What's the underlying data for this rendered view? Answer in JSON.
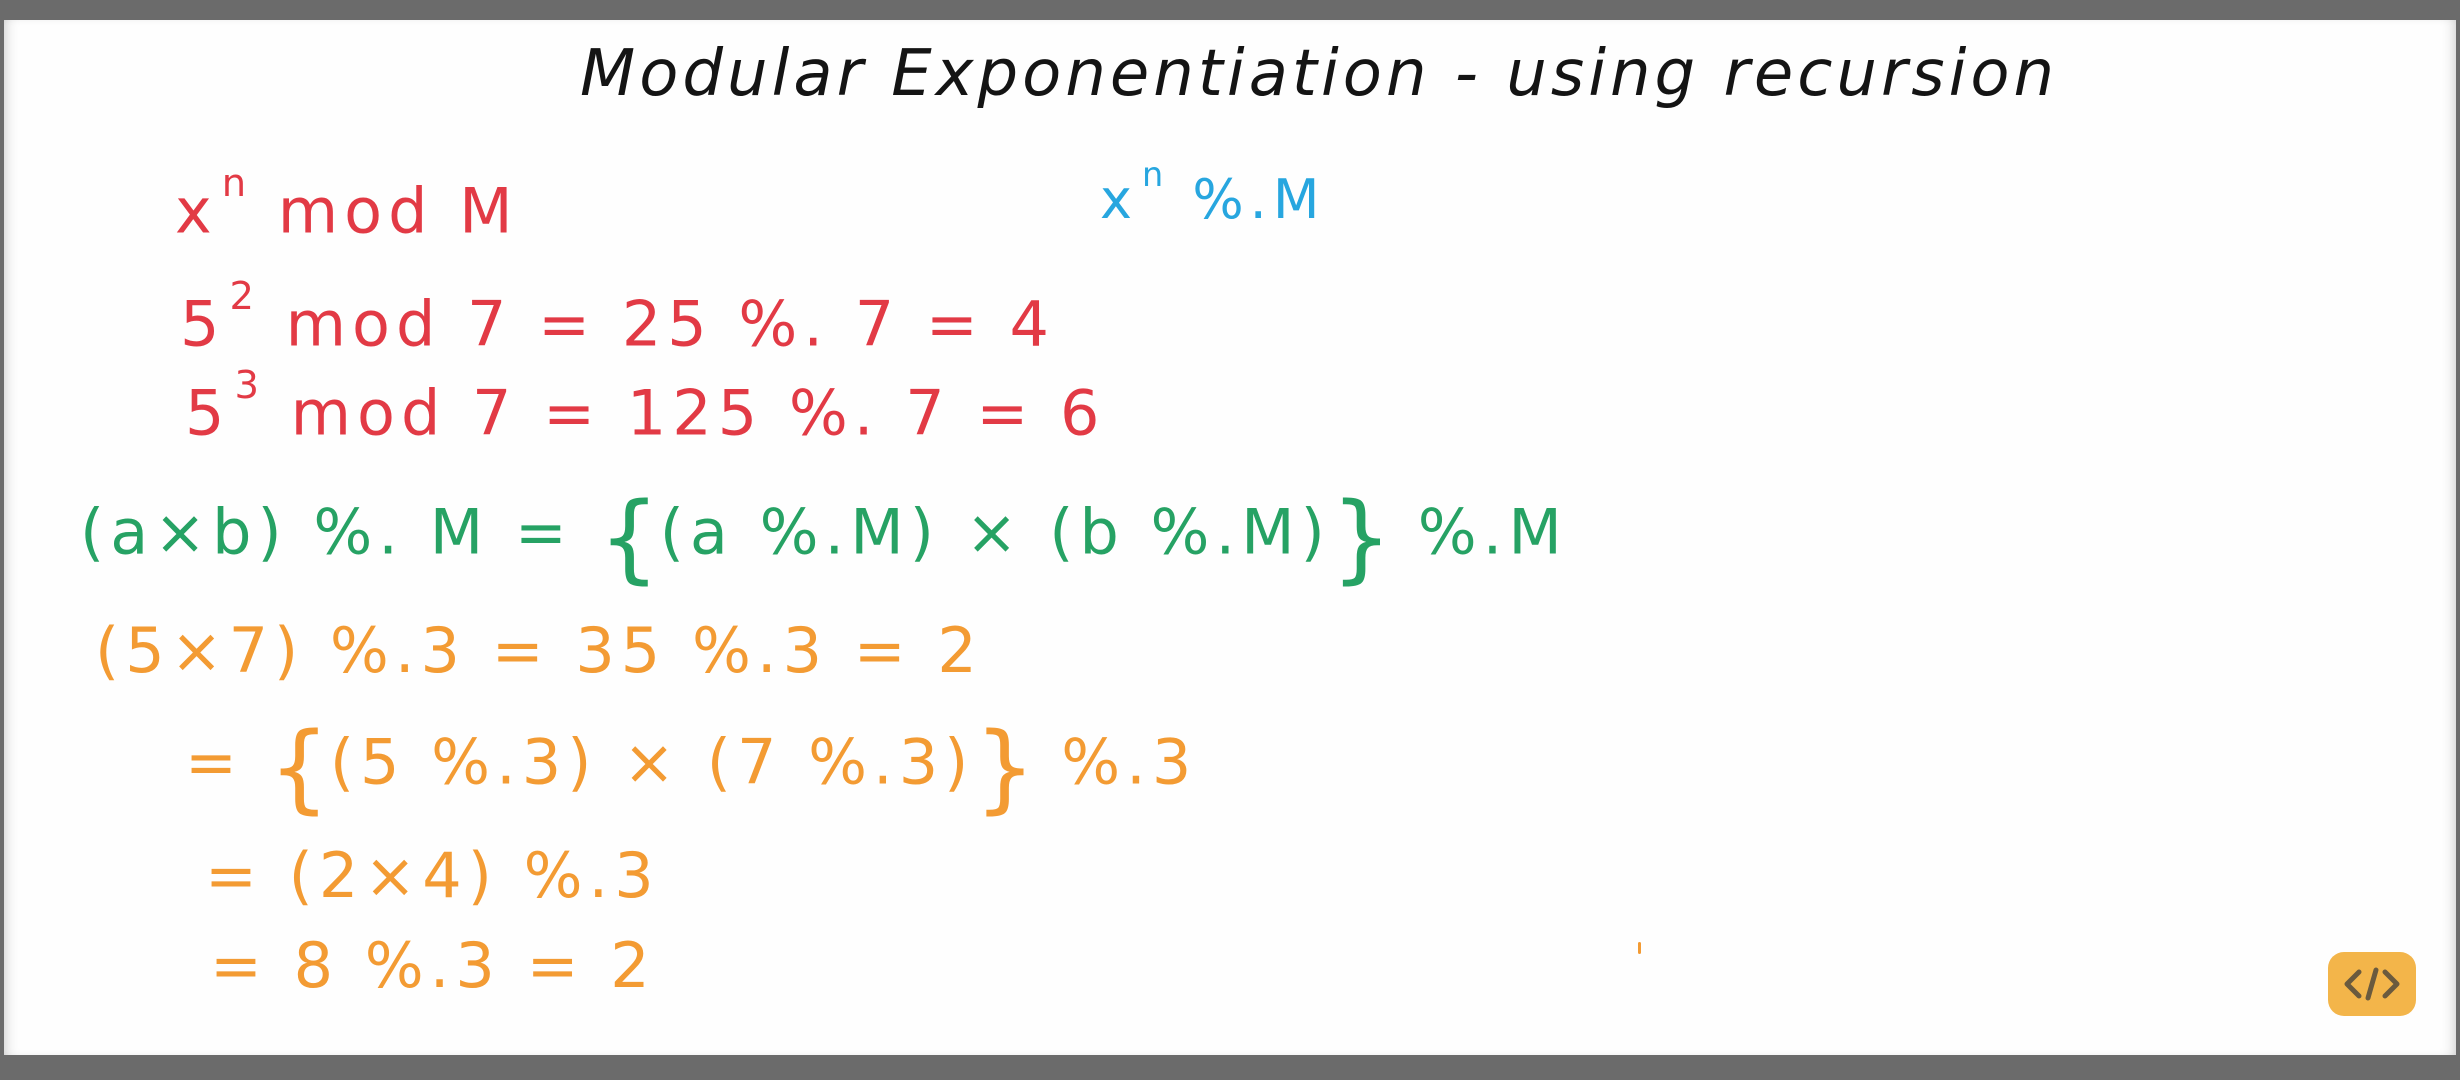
{
  "title": "Modular Exponentiation - using recursion",
  "lines": {
    "line1_base": "x",
    "line1_exp": "n",
    "line1_rest": " mod M",
    "blue_base": "x",
    "blue_exp": "n",
    "blue_rest": " %.M",
    "line2_base": "5",
    "line2_exp": "2",
    "line2_rest": " mod 7 = 25 %. 7 = 4",
    "line3_base": "5",
    "line3_exp": "3",
    "line3_rest": " mod 7 = 125 %. 7 = 6",
    "green_left": "(a×b) %. M  =  ",
    "green_open": "{",
    "green_mid": "(a %.M) × (b %.M)",
    "green_close": "}",
    "green_right": " %.M",
    "orange1": "(5×7) %.3  =  35 %.3 = 2",
    "orange2_pre": "= ",
    "orange2_open": "{",
    "orange2_mid": "(5 %.3) × (7 %.3)",
    "orange2_close": "}",
    "orange2_post": " %.3",
    "orange3": "=  (2×4) %.3",
    "orange4": "=  8 %.3 = 2"
  },
  "colors": {
    "title": "#141414",
    "red": "#e23a45",
    "blue": "#27a6df",
    "green": "#26a264",
    "orange": "#f39b33",
    "logo": "#f3b54a"
  },
  "logo_icon": "code-brackets-icon"
}
